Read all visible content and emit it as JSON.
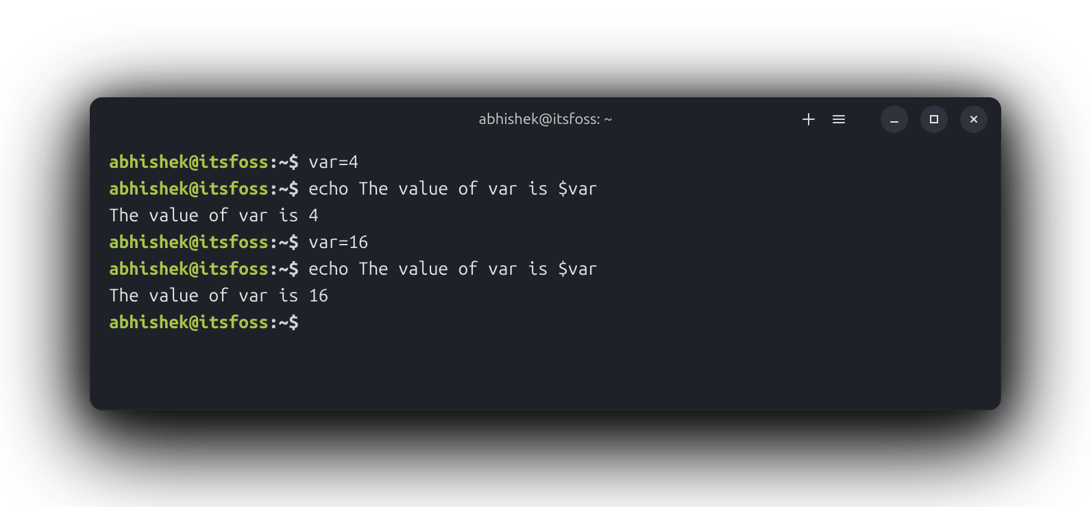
{
  "window": {
    "title": "abhishek@itsfoss: ~"
  },
  "icons": {
    "new_tab": "new-tab",
    "menu": "menu",
    "minimize": "minimize",
    "maximize": "maximize",
    "close": "close"
  },
  "prompt": {
    "user_host": "abhishek@itsfoss",
    "colon": ":",
    "path": "~",
    "dollar": "$ "
  },
  "lines": [
    {
      "type": "cmd",
      "command": "var=4"
    },
    {
      "type": "cmd",
      "command": "echo The value of var is $var"
    },
    {
      "type": "out",
      "text": "The value of var is 4"
    },
    {
      "type": "cmd",
      "command": "var=16"
    },
    {
      "type": "cmd",
      "command": "echo The value of var is $var"
    },
    {
      "type": "out",
      "text": "The value of var is 16"
    },
    {
      "type": "cmd",
      "command": ""
    }
  ]
}
